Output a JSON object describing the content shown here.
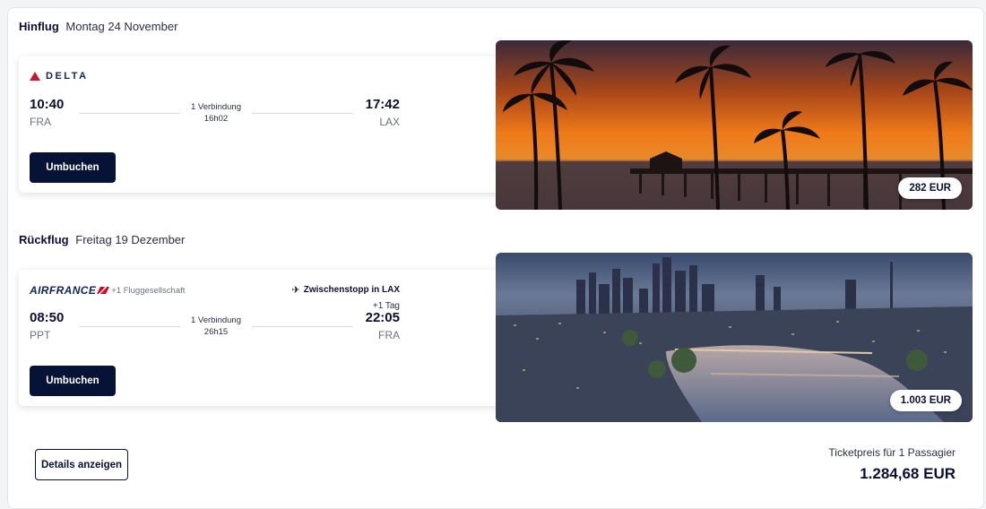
{
  "outbound": {
    "label": "Hinflug",
    "date": "Montag 24 November",
    "airline": "DELTA",
    "depart_time": "10:40",
    "depart_code": "FRA",
    "arrive_time": "17:42",
    "arrive_code": "LAX",
    "connections": "1 Verbindung",
    "duration": "16h02",
    "rebook_label": "Umbuchen",
    "price": "282 EUR",
    "image": "sunset-palm-pier-icon"
  },
  "return": {
    "label": "Rückflug",
    "date": "Freitag 19 Dezember",
    "airline": "AIRFRANCE",
    "extra_airline": "+1 Fluggesellschaft",
    "stopover": "Zwischenstopp in LAX",
    "depart_time": "08:50",
    "depart_code": "PPT",
    "arrive_time": "22:05",
    "arrive_code": "FRA",
    "plus_day": "+1 Tag",
    "connections": "1 Verbindung",
    "duration": "26h15",
    "rebook_label": "Umbuchen",
    "price": "1.003 EUR",
    "image": "city-skyline-river-icon"
  },
  "footer": {
    "details_label": "Details anzeigen",
    "ticket_label": "Ticketpreis für 1 Passagier",
    "ticket_total": "1.284,68 EUR"
  },
  "colors": {
    "primary": "#071237",
    "delta_red": "#c01933",
    "airfrance_red": "#e2001a"
  }
}
